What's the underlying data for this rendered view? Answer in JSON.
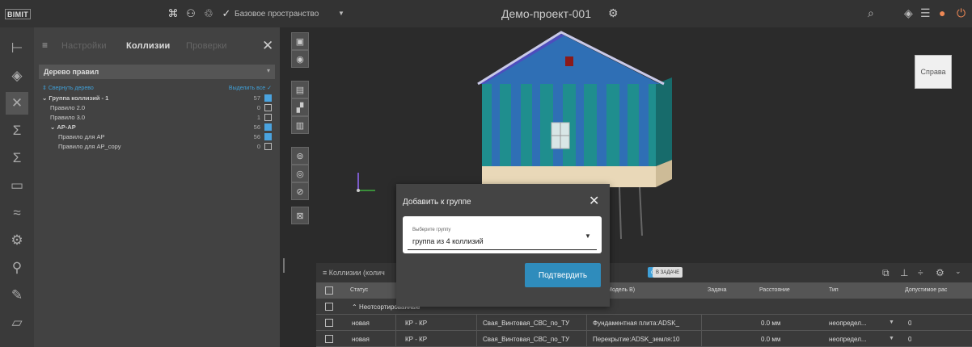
{
  "topbar": {
    "logo": "BIMIT",
    "workspace": "Базовое пространство",
    "project_title": "Демо-проект-001",
    "icons": [
      "briefcase-icon",
      "people-icon",
      "share-icon",
      "check-circle-icon"
    ]
  },
  "left_panel": {
    "tabs": [
      {
        "label": "Настройки",
        "active": false
      },
      {
        "label": "Коллизии",
        "active": true
      },
      {
        "label": "Проверки",
        "active": false
      }
    ],
    "tree_title": "Дерево правил",
    "collapse_label": "Свернуть дерево",
    "select_all_label": "Выделить все",
    "rules": [
      {
        "label": "Группа коллизий - 1",
        "count": "57",
        "state": "partial"
      },
      {
        "label": "Правило 2.0",
        "count": "0",
        "state": "off"
      },
      {
        "label": "Правило 3.0",
        "count": "1",
        "state": "off"
      },
      {
        "label": "АР-АР",
        "count": "56",
        "state": "partial"
      },
      {
        "label": "Правило для АР",
        "count": "56",
        "state": "on"
      },
      {
        "label": "Правило для АР_copy",
        "count": "0",
        "state": "off"
      }
    ]
  },
  "viewer": {
    "viewcube_label": "Справа"
  },
  "dialog": {
    "title": "Добавить к группе",
    "select_label": "Выберите группу",
    "select_value": "группа из 4 коллизий",
    "confirm_label": "Подтвердить"
  },
  "bottom": {
    "title": "Коллизии (колич",
    "chip_collisions": "оллизии",
    "chip_task": "В ЗАДАЧЕ",
    "headers": [
      "Статус",
      "мент (Модель B)",
      "Задача",
      "Расстояние",
      "Тип",
      "Допустимое рас"
    ],
    "group_row": "Неотсортированные",
    "rows": [
      {
        "status": "новая",
        "disciplines": "КР - КР",
        "element_a": "Свая_Винтовая_СВС_по_ТУ",
        "element_b": "Фундаментная плита:ADSK_",
        "distance": "0.0 мм",
        "type": "неопредел...",
        "tolerance": "0"
      },
      {
        "status": "новая",
        "disciplines": "КР - КР",
        "element_a": "Свая_Винтовая_СВС_по_ТУ",
        "element_b": "Перекрытие:ADSK_земля:10",
        "distance": "0.0 мм",
        "type": "неопредел...",
        "tolerance": "0"
      }
    ]
  },
  "colors": {
    "accent": "#3fa0d8",
    "confirm_button": "#2f8cbc",
    "house_teal": "#1f8e8e",
    "house_blue": "#2f6fb5"
  }
}
